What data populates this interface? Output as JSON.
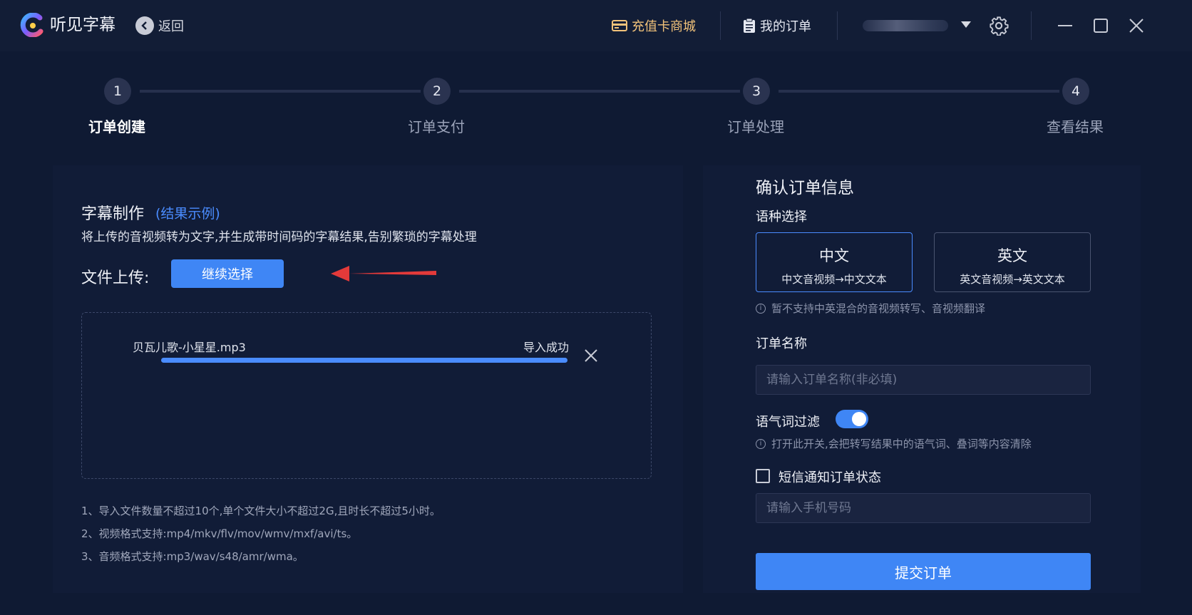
{
  "app": {
    "name": "听见字幕",
    "back_label": "返回"
  },
  "topbar": {
    "shop_label": "充值卡商城",
    "orders_label": "我的订单",
    "colors": {
      "shop": "#f1c27a",
      "accent": "#3f86f5"
    }
  },
  "steps": [
    {
      "number": "1",
      "label": "订单创建",
      "active": true
    },
    {
      "number": "2",
      "label": "订单支付",
      "active": false
    },
    {
      "number": "3",
      "label": "订单处理",
      "active": false
    },
    {
      "number": "4",
      "label": "查看结果",
      "active": false
    }
  ],
  "left": {
    "title": "字幕制作",
    "example_link": "(结果示例)",
    "description": "将上传的音视频转为文字,并生成带时间码的字幕结果,告别繁琐的字幕处理",
    "upload_label": "文件上传:",
    "select_button": "继续选择",
    "file": {
      "name": "贝瓦儿歌-小星星.mp3",
      "status": "导入成功",
      "progress": 1.0
    },
    "notes": [
      "1、导入文件数量不超过10个,单个文件大小不超过2G,且时长不超过5小时。",
      "2、视频格式支持:mp4/mkv/flv/mov/wmv/mxf/avi/ts。",
      "3、音频格式支持:mp3/wav/s48/amr/wma。"
    ]
  },
  "right": {
    "title": "确认订单信息",
    "language_label": "语种选择",
    "languages": [
      {
        "main": "中文",
        "sub": "中文音视频→中文文本",
        "selected": true
      },
      {
        "main": "英文",
        "sub": "英文音视频→英文文本",
        "selected": false
      }
    ],
    "language_hint": "暂不支持中英混合的音视频转写、音视频翻译",
    "order_name_label": "订单名称",
    "order_name_placeholder": "请输入订单名称(非必填)",
    "filter_label": "语气词过滤",
    "filter_enabled": true,
    "filter_hint": "打开此开关,会把转写结果中的语气词、叠词等内容清除",
    "sms_label": "短信通知订单状态",
    "sms_checked": false,
    "phone_placeholder": "请输入手机号码",
    "submit_label": "提交订单"
  }
}
